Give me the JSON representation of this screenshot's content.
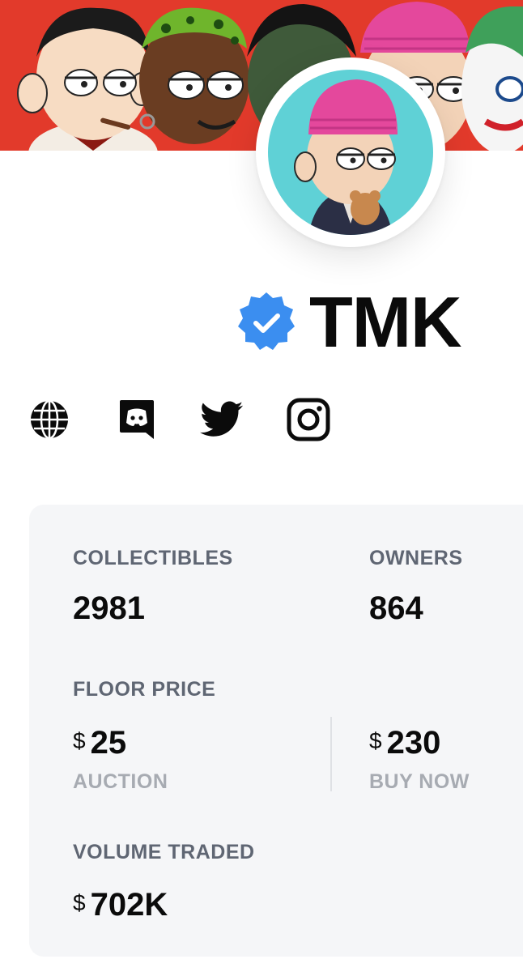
{
  "collection": {
    "name": "TMK",
    "verified": true
  },
  "icons": {
    "verified": "verified-badge-icon",
    "website": "globe-icon",
    "discord": "discord-icon",
    "twitter": "twitter-icon",
    "instagram": "instagram-icon"
  },
  "colors": {
    "banner_bg": "#e23a2b",
    "avatar_bg": "#5fd1d6",
    "verified": "#3b8ef0",
    "card_bg": "#f5f6f8",
    "label": "#5f6673",
    "muted": "#a7abb2"
  },
  "stats": {
    "collectibles": {
      "label": "COLLECTIBLES",
      "value": "2981"
    },
    "owners": {
      "label": "OWNERS",
      "value": "864"
    },
    "floor_price": {
      "label": "FLOOR PRICE",
      "auction": {
        "currency": "$",
        "value": "25",
        "label": "AUCTION"
      },
      "buy_now": {
        "currency": "$",
        "value": "230",
        "label": "BUY NOW"
      }
    },
    "volume_traded": {
      "label": "VOLUME TRADED",
      "currency": "$",
      "value": "702K"
    }
  }
}
